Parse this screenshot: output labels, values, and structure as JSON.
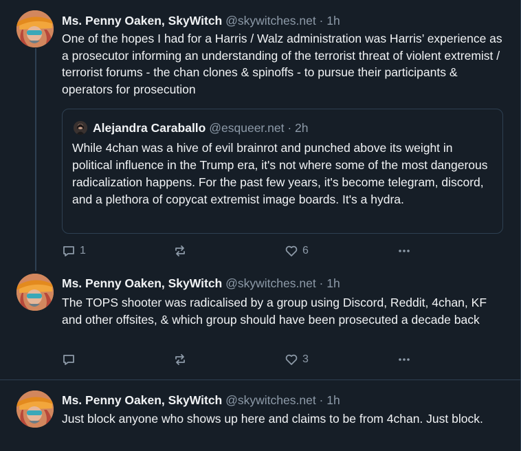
{
  "thread": [
    {
      "author_name": "Ms. Penny Oaken, SkyWitch",
      "meta": "@skywitches.net · 1h",
      "text": "One of the hopes I had for a Harris / Walz administration was Harris’ experience as a prosecutor informing an understanding of the terrorist threat of violent extremist / terrorist forums - the chan clones & spinoffs - to pursue their participants & operators for prosecution",
      "quote": {
        "author_name": "Alejandra Caraballo",
        "meta": "@esqueer.net · 2h",
        "text": "While 4chan was a hive of evil brainrot and punched above its weight in political influence in the Trump era, it's not where some of the most dangerous radicalization happens. For the past few years, it's become telegram, discord, and a plethora of copycat extremist image boards. It's a hydra."
      },
      "replies": "1",
      "reposts": "",
      "likes": "6"
    },
    {
      "author_name": "Ms. Penny Oaken, SkyWitch",
      "meta": "@skywitches.net · 1h",
      "text": "The TOPS shooter was radicalised by a group using Discord, Reddit, 4chan, KF and other offsites, & which group should have been prosecuted a decade back",
      "replies": "",
      "reposts": "",
      "likes": "3"
    },
    {
      "author_name": "Ms. Penny Oaken, SkyWitch",
      "meta": "@skywitches.net · 1h",
      "text": "Just block anyone who shows up here and claims to be from 4chan. Just block."
    }
  ],
  "icons": {
    "reply": "comment-icon",
    "repost": "repost-icon",
    "like": "heart-icon",
    "more": "more-icon"
  },
  "colors": {
    "background": "#161e27",
    "border": "#2e4052",
    "muted_text": "#8d9aa8",
    "primary_text": "#f1f3f5"
  }
}
